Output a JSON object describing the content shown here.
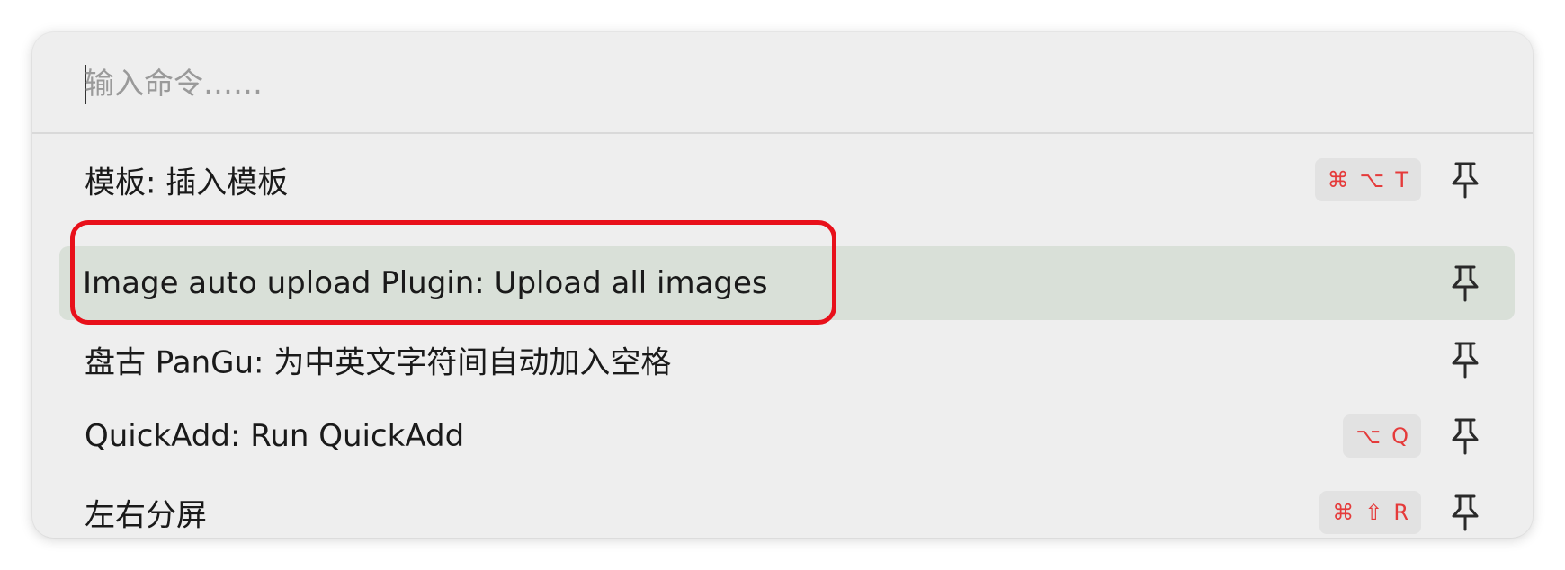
{
  "search": {
    "placeholder": "输入命令……",
    "value": ""
  },
  "suggestions": [
    {
      "label": "模板: 插入模板",
      "hotkey": [
        "⌘",
        "⌥",
        "T"
      ],
      "selected": false,
      "pin_icon": "pin-icon"
    },
    {
      "label": "Image auto upload Plugin: Upload all images",
      "hotkey": [],
      "selected": true,
      "pin_icon": "pin-icon"
    },
    {
      "label": "盘古 PanGu: 为中英文字符间自动加入空格",
      "hotkey": [],
      "selected": false,
      "pin_icon": "pin-icon"
    },
    {
      "label": "QuickAdd: Run QuickAdd",
      "hotkey": [
        "⌥",
        "Q"
      ],
      "selected": false,
      "pin_icon": "pin-icon"
    },
    {
      "label": "左右分屏",
      "hotkey": [
        "⌘",
        "⇧",
        "R"
      ],
      "selected": false,
      "pin_icon": "pin-icon"
    }
  ],
  "colors": {
    "selected_background": "#d9e0d8",
    "hotkey_text": "#e53b3b",
    "annotation_border": "#e8101a"
  }
}
